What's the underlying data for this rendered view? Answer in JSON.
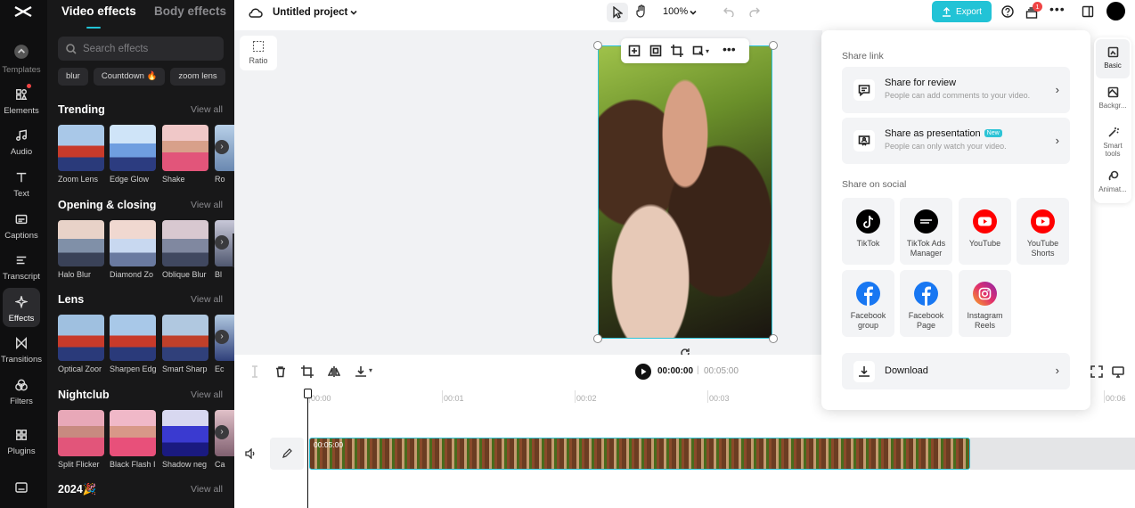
{
  "rail": {
    "items": [
      {
        "label": "Templates"
      },
      {
        "label": "Elements"
      },
      {
        "label": "Audio"
      },
      {
        "label": "Text"
      },
      {
        "label": "Captions"
      },
      {
        "label": "Transcript"
      },
      {
        "label": "Effects"
      },
      {
        "label": "Transitions"
      },
      {
        "label": "Filters"
      },
      {
        "label": "Plugins"
      }
    ]
  },
  "panel": {
    "tabs": [
      "Video effects",
      "Body effects"
    ],
    "search_placeholder": "Search effects",
    "chips": [
      "blur",
      "Countdown 🔥",
      "zoom lens"
    ],
    "view_all": "View all",
    "sections": [
      {
        "title": "Trending",
        "items": [
          "Zoom Lens",
          "Edge Glow",
          "Shake",
          "Ro"
        ]
      },
      {
        "title": "Opening & closing",
        "items": [
          "Halo Blur",
          "Diamond Zo",
          "Oblique Blur",
          "Bl"
        ]
      },
      {
        "title": "Lens",
        "items": [
          "Optical Zoor",
          "Sharpen Edg",
          "Smart Sharp",
          "Ec"
        ]
      },
      {
        "title": "Nightclub",
        "items": [
          "Split Flicker",
          "Black Flash I",
          "Shadow neg",
          "Ca"
        ]
      },
      {
        "title": "2024🎉",
        "items": []
      }
    ]
  },
  "topbar": {
    "project_title": "Untitled project",
    "zoom": "100%",
    "export_label": "Export",
    "notif_count": "1"
  },
  "canvas": {
    "ratio_label": "Ratio"
  },
  "timeline": {
    "current_time": "00:00:00",
    "separator": "|",
    "total_time": "00:05:00",
    "ruler": [
      "00:00",
      "00:01",
      "00:02",
      "00:03",
      "00:06"
    ],
    "clip_duration": "00:05:00"
  },
  "share": {
    "link_heading": "Share link",
    "review_title": "Share for review",
    "review_sub": "People can add comments to your video.",
    "present_title": "Share as presentation",
    "present_badge": "New",
    "present_sub": "People can only watch your video.",
    "social_heading": "Share on social",
    "social": [
      {
        "name": "TikTok",
        "color": "#000000"
      },
      {
        "name": "TikTok Ads Manager",
        "color": "#000000"
      },
      {
        "name": "YouTube",
        "color": "#ff0000"
      },
      {
        "name": "YouTube Shorts",
        "color": "#ff0000"
      },
      {
        "name": "Facebook group",
        "color": "#1877f2"
      },
      {
        "name": "Facebook Page",
        "color": "#1877f2"
      },
      {
        "name": "Instagram Reels",
        "color": "#e1306c"
      }
    ],
    "download_label": "Download"
  },
  "right_tabs": [
    "Basic",
    "Backgr...",
    "Smart tools",
    "Animat..."
  ],
  "accent": "#22c3d6"
}
